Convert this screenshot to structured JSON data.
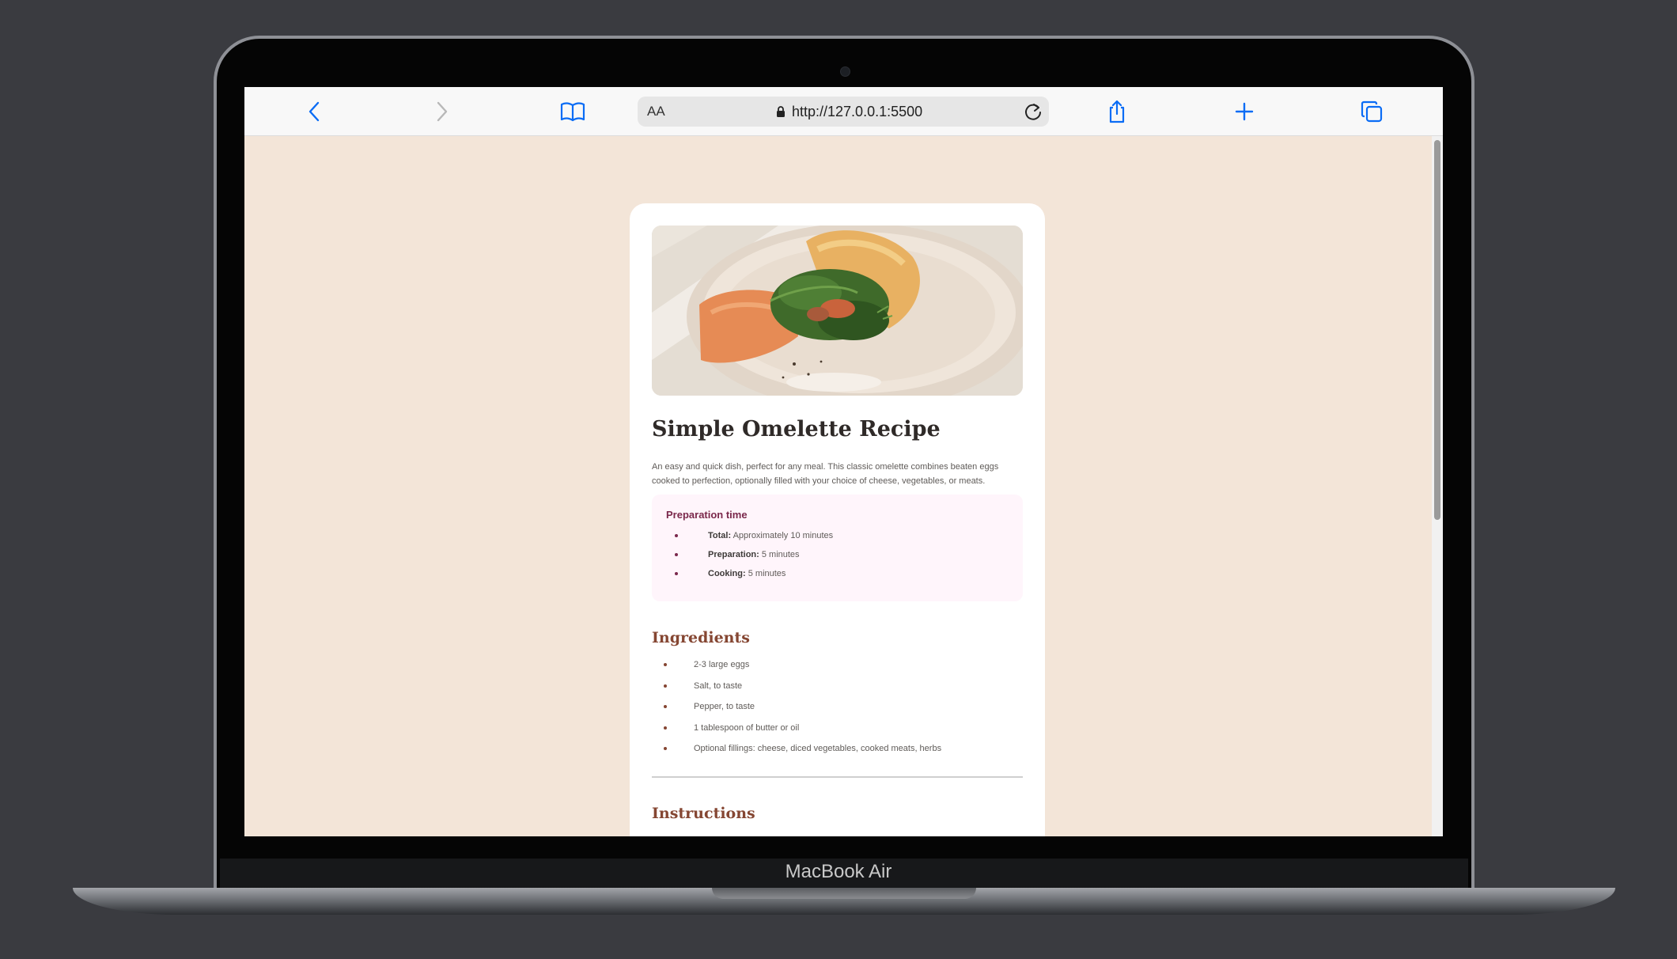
{
  "device": {
    "label": "MacBook Air"
  },
  "browser": {
    "text_size_label": "AA",
    "url": "http://127.0.0.1:5500",
    "icons": [
      "back-icon",
      "forward-icon",
      "bookmarks-icon",
      "lock-icon",
      "reload-icon",
      "share-icon",
      "new-tab-icon",
      "tabs-icon"
    ]
  },
  "recipe": {
    "title": "Simple Omelette Recipe",
    "description": "An easy and quick dish, perfect for any meal. This classic omelette combines beaten eggs cooked to perfection, optionally filled with your choice of cheese, vegetables, or meats.",
    "preparation": {
      "heading": "Preparation time",
      "items": [
        {
          "label": "Total:",
          "value": "Approximately 10 minutes"
        },
        {
          "label": "Preparation:",
          "value": "5 minutes"
        },
        {
          "label": "Cooking:",
          "value": "5 minutes"
        }
      ]
    },
    "ingredients": {
      "heading": "Ingredients",
      "items": [
        "2-3 large eggs",
        "Salt, to taste",
        "Pepper, to taste",
        "1 tablespoon of butter or oil",
        "Optional fillings: cheese, diced vegetables, cooked meats, herbs"
      ]
    },
    "instructions": {
      "heading": "Instructions"
    }
  },
  "colors": {
    "page_background": "#f3e5d8",
    "accent_rose": "#7a284b",
    "accent_brown": "#854632",
    "link_blue": "#0a6cf5"
  }
}
